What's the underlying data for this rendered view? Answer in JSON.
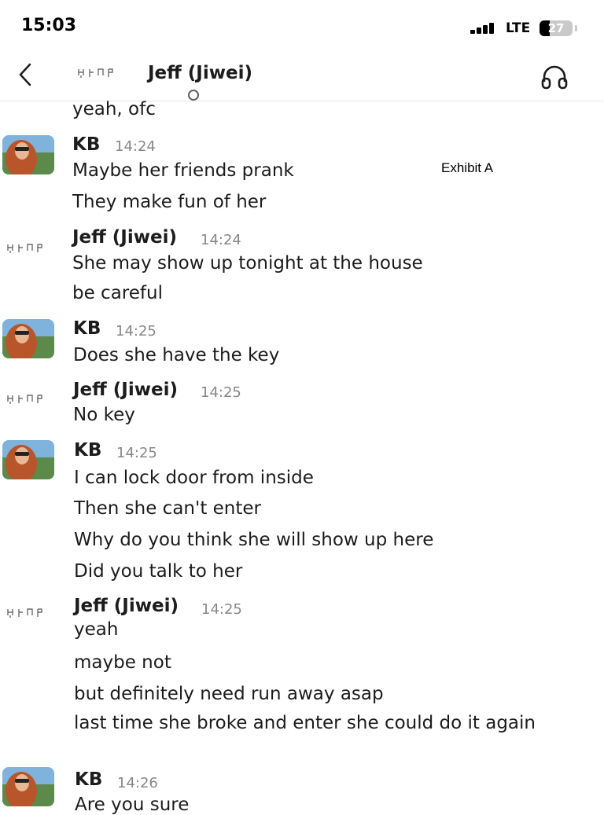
{
  "status_bar": {
    "time": "15:03",
    "network": "LTE",
    "battery": "27"
  },
  "header": {
    "title": "Jeff (Jiwei)"
  },
  "overlay": {
    "exhibit_label": "Exhibit A"
  },
  "messages": [
    {
      "sender": "",
      "time": "",
      "lines": [
        "yeah, ofc"
      ]
    },
    {
      "sender": "KB",
      "time": "14:24",
      "lines": [
        "Maybe her friends prank",
        "They make fun of her"
      ]
    },
    {
      "sender": "Jeff (Jiwei)",
      "time": "14:24",
      "lines": [
        "She may show up tonight at the house",
        "be careful"
      ]
    },
    {
      "sender": "KB",
      "time": "14:25",
      "lines": [
        "Does she have the key"
      ]
    },
    {
      "sender": "Jeff (Jiwei)",
      "time": "14:25",
      "lines": [
        "No key"
      ]
    },
    {
      "sender": "KB",
      "time": "14:25",
      "lines": [
        "I can lock door from inside",
        "Then she can't enter",
        "Why do you think she will show up here",
        "Did you talk to her"
      ]
    },
    {
      "sender": "Jeff (Jiwei)",
      "time": "14:25",
      "lines": [
        "yeah",
        "maybe not",
        "but definitely need run away asap",
        "last time she broke and enter she could do it again"
      ]
    },
    {
      "sender": "KB",
      "time": "14:26",
      "lines": [
        "Are you sure"
      ]
    }
  ],
  "colors": {
    "text": "#1d1c1d",
    "timestamp": "#878787",
    "divider": "#e4e4e4"
  },
  "icons": {
    "back": "chevron-left-icon",
    "call": "headphones-icon",
    "jeff_avatar": "script-glyph-avatar",
    "kb_avatar": "photo-avatar"
  }
}
